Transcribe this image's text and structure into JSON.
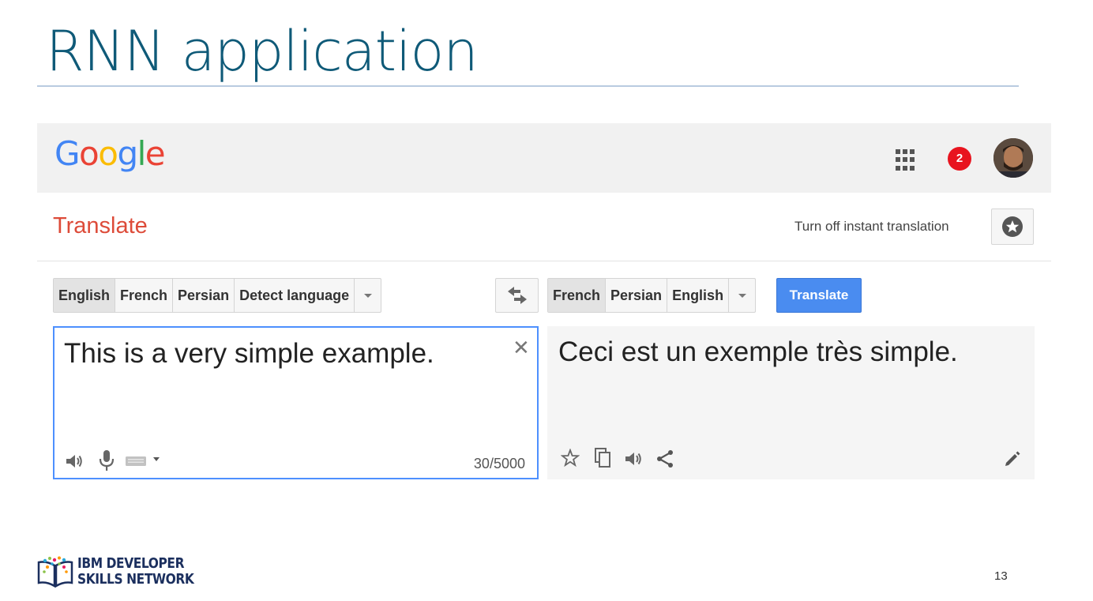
{
  "slide": {
    "title": "RNN application",
    "page_number": "13",
    "footer_logo": {
      "line1": "IBM DEVELOPER",
      "line2": "SKILLS NETWORK"
    }
  },
  "header": {
    "logo_letters": [
      {
        "char": "G",
        "color": "#4285f4"
      },
      {
        "char": "o",
        "color": "#ea4335"
      },
      {
        "char": "o",
        "color": "#fbbc05"
      },
      {
        "char": "g",
        "color": "#4285f4"
      },
      {
        "char": "l",
        "color": "#34a853"
      },
      {
        "char": "e",
        "color": "#ea4335"
      }
    ],
    "notification_count": "2"
  },
  "translate": {
    "title": "Translate",
    "instant_link": "Turn off instant translation",
    "source_languages": [
      "English",
      "French",
      "Persian",
      "Detect language"
    ],
    "source_active": "English",
    "target_languages": [
      "French",
      "Persian",
      "English"
    ],
    "target_active": "French",
    "translate_button": "Translate",
    "source_text": "This is a very simple example.",
    "char_count": "30/5000",
    "result_text": "Ceci est un exemple très simple."
  },
  "colors": {
    "title": "#0f5a78",
    "translate_title": "#dd4b39",
    "accent_blue": "#4a8cf0",
    "badge_red": "#e8141f"
  }
}
